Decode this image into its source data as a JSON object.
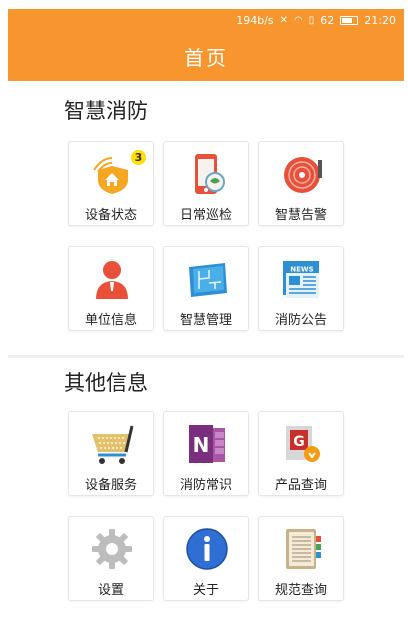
{
  "status_bar": {
    "speed": "194b/s",
    "battery": "62",
    "time": "21:20"
  },
  "header": {
    "title": "首页"
  },
  "sections": [
    {
      "title": "智慧消防",
      "tiles": [
        {
          "label": "设备状态",
          "icon": "device-status-icon",
          "badge": "3"
        },
        {
          "label": "日常巡检",
          "icon": "phone-inspection-icon"
        },
        {
          "label": "智慧告警",
          "icon": "alarm-bell-icon"
        },
        {
          "label": "单位信息",
          "icon": "person-icon"
        },
        {
          "label": "智慧管理",
          "icon": "blueprint-icon"
        },
        {
          "label": "消防公告",
          "icon": "news-icon"
        }
      ]
    },
    {
      "title": "其他信息",
      "tiles": [
        {
          "label": "设备服务",
          "icon": "shopping-cart-icon"
        },
        {
          "label": "消防常识",
          "icon": "notebook-icon"
        },
        {
          "label": "产品查询",
          "icon": "product-search-icon"
        },
        {
          "label": "设置",
          "icon": "gear-icon"
        },
        {
          "label": "关于",
          "icon": "info-icon"
        },
        {
          "label": "规范查询",
          "icon": "spec-book-icon"
        }
      ]
    }
  ],
  "colors": {
    "brand_orange": "#f7962f",
    "tile_border": "#e6e6e6"
  }
}
